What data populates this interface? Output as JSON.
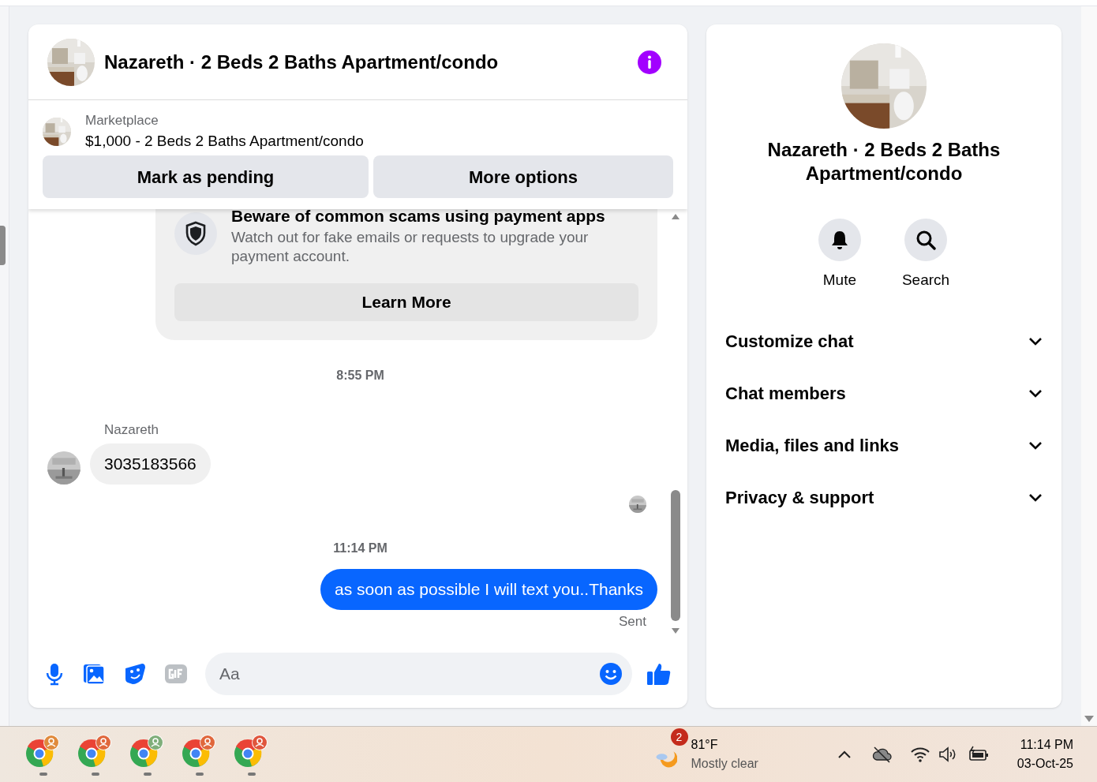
{
  "conversation": {
    "title": "Nazareth · 2 Beds 2 Baths Apartment/condo"
  },
  "listing": {
    "source": "Marketplace",
    "summary": "$1,000 - 2 Beds 2 Baths Apartment/condo",
    "actions": [
      "Mark as pending",
      "More options"
    ]
  },
  "notice": {
    "title": "Beware of common scams using payment apps",
    "body": "Watch out for fake emails or requests to upgrade your payment account.",
    "action": "Learn More"
  },
  "messages": [
    {
      "kind": "time",
      "text": "8:55 PM"
    },
    {
      "kind": "incoming",
      "sender": "Nazareth",
      "text": "3035183566"
    },
    {
      "kind": "seen"
    },
    {
      "kind": "time",
      "text": "11:14 PM"
    },
    {
      "kind": "outgoing",
      "text": "as soon as possible I will text you..Thanks",
      "status": "Sent"
    }
  ],
  "composer": {
    "placeholder": "Aa"
  },
  "details": {
    "title": "Nazareth · 2 Beds 2 Baths Apartment/condo",
    "actions": [
      {
        "kind": "mute",
        "label": "Mute"
      },
      {
        "kind": "search",
        "label": "Search"
      }
    ],
    "sections": [
      {
        "label": "Customize chat",
        "expanded": false
      },
      {
        "label": "Chat members",
        "expanded": false
      },
      {
        "label": "Media, files and links",
        "expanded": false
      },
      {
        "label": "Privacy & support",
        "expanded": false
      }
    ]
  },
  "taskbar": {
    "apps": [
      {
        "color": "#e08a3c"
      },
      {
        "color": "#e0673c"
      },
      {
        "color": "#7fae7a"
      },
      {
        "color": "#e0673c"
      },
      {
        "color": "#e0553c"
      }
    ],
    "weather": {
      "badge": "2",
      "temperature": "81°F",
      "condition": "Mostly clear"
    },
    "clock": {
      "time": "11:14 PM",
      "date": "03-Oct-25"
    }
  }
}
